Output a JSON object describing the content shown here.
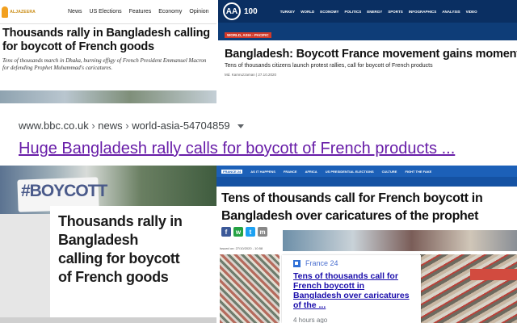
{
  "aljazeera": {
    "logo_text": "ALJAZEERA",
    "nav": [
      "News",
      "US Elections",
      "Features",
      "Economy",
      "Opinion"
    ],
    "headline": "Thousands rally in Bangladesh calling for boycott of French goods",
    "subhead": "Tens of thousands march in Dhaka, burning effigy of French President Emmanuel Macron for defending Prophet Muhammad's caricatures."
  },
  "anadolu": {
    "logo": "AA",
    "logo_sub": "100",
    "nav": [
      "TURKEY",
      "WORLD",
      "ECONOMY",
      "POLITICS",
      "ENERGY",
      "SPORTS",
      "INFOGRAPHICS",
      "ANALYSIS",
      "VIDEO"
    ],
    "tag": "WORLD, ASIA - PACIFIC",
    "headline": "Bangladesh: Boycott France movement gains moment",
    "subhead": "Tens of thousands citizens launch protest rallies, call for boycott of French products",
    "byline": "Md. Kamruzzaman | 27.10.2020"
  },
  "result": {
    "breadcrumb": [
      "www.bbc.co.uk",
      "news",
      "world-asia-54704859"
    ],
    "separator": "›",
    "title": "Huge Bangladesh rally calls for boycott of French products ..."
  },
  "boycott_photo": {
    "sign_text": "#BOYCOTT",
    "headline_lines": [
      "Thousands rally in",
      "Bangladesh",
      "calling for boycott",
      "of French goods"
    ]
  },
  "france24": {
    "nav1": [
      "FRANCE 24",
      "AS IT HAPPENS",
      "FRANCE",
      "AFRICA",
      "US PRESIDENTIAL ELECTIONS",
      "CULTURE",
      "FIGHT THE FAKE"
    ],
    "headline": "Tens of thousands call for French boycott in Bangladesh over caricatures of the prophet",
    "share_icons": [
      "f",
      "w",
      "t",
      "m"
    ],
    "issued": "Issued on: 27/10/2020 - 10:58"
  },
  "google_card": {
    "source": "France 24",
    "link": "Tens of thousands call for French boycott in Bangladesh over caricatures of the ...",
    "time": "4 hours ago"
  },
  "colors": {
    "link_visited": "#681da8",
    "link": "#1a0dab",
    "anadolu_blue": "#0e3d78",
    "france24_blue": "#1c60b8"
  }
}
